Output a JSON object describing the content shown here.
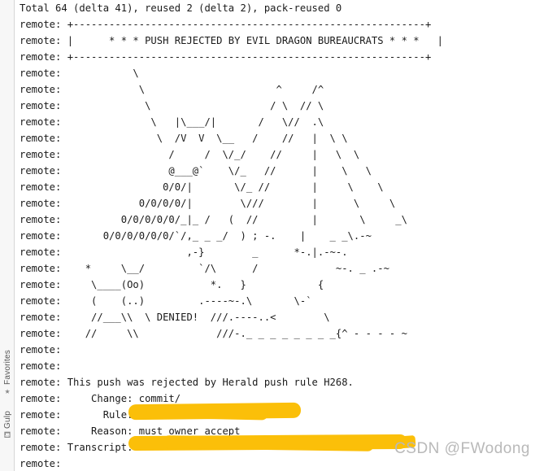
{
  "window": {
    "background_color": "#ffffff",
    "text_color": "#1a1a1a",
    "highlight_color": "#fbbf09",
    "link_color": "#3f6fa8"
  },
  "sidebar": {
    "groups": [
      {
        "label": "Favorites",
        "icon": "star-icon",
        "icon_glyph": "★"
      },
      {
        "label": "Gulp",
        "icon": "cup-icon",
        "icon_glyph": "⛾"
      }
    ]
  },
  "console": {
    "lines": [
      "Total 64 (delta 41), reused 2 (delta 2), pack-reused 0",
      "remote: +-----------------------------------------------------------+",
      "remote: |      * * * PUSH REJECTED BY EVIL DRAGON BUREAUCRATS * * *   |",
      "remote: +-----------------------------------------------------------+",
      "remote:            \\",
      "remote:             \\                      ^     /^",
      "remote:              \\                    / \\  // \\",
      "remote:               \\   |\\___/|       /   \\//  .\\",
      "remote:                \\  /V  V  \\__   /    //   |  \\ \\",
      "remote:                  /     /  \\/_/    //     |   \\  \\",
      "remote:                  @___@`    \\/_   //      |    \\   \\",
      "remote:                 0/0/|       \\/_ //       |     \\    \\",
      "remote:             0/0/0/0/|        \\///        |      \\     \\",
      "remote:          0/0/0/0/0/_|_ /   (  //         |       \\     _\\",
      "remote:       0/0/0/0/0/0/`/,_ _ _/  ) ; -.    |    _ _\\.-~",
      "remote:                     ,-}        _      *-.|.-~-.",
      "remote:    *     \\__/         `/\\      /             ~-. _ .-~",
      "remote:     \\____(Oo)           *.   }            {",
      "remote:     (    (..)         .----~-.\\       \\-`",
      "remote:     //___\\\\  \\ DENIED!  ///.----..<        \\",
      "remote:    //     \\\\             ///-._ _ _ _ _ _ _ _{^ - - - - ~",
      "remote:",
      "remote:",
      "remote: This push was rejected by Herald push rule H268.",
      "remote:     Change: commit/",
      "remote:       Rule:",
      "remote:     Reason: must owner accept",
      "remote: Transcript:",
      "remote:"
    ],
    "redacted_rule_value": "",
    "redacted_transcript_value": "",
    "rejection_message": "This push was rejected by Herald push rule H268.",
    "change_label": "Change:",
    "change_value": "commit/",
    "rule_label": "Rule:",
    "reason_label": "Reason:",
    "reason_value": "must owner accept",
    "transcript_label": "Transcript:",
    "header_banner": "* * * PUSH REJECTED BY EVIL DRAGON BUREAUCRATS * * *",
    "summary": "Total 64 (delta 41), reused 2 (delta 2), pack-reused 0",
    "denied_word": "DENIED!",
    "herald_rule_id": "H268"
  },
  "watermark": {
    "text": "CSDN @FWodong"
  }
}
